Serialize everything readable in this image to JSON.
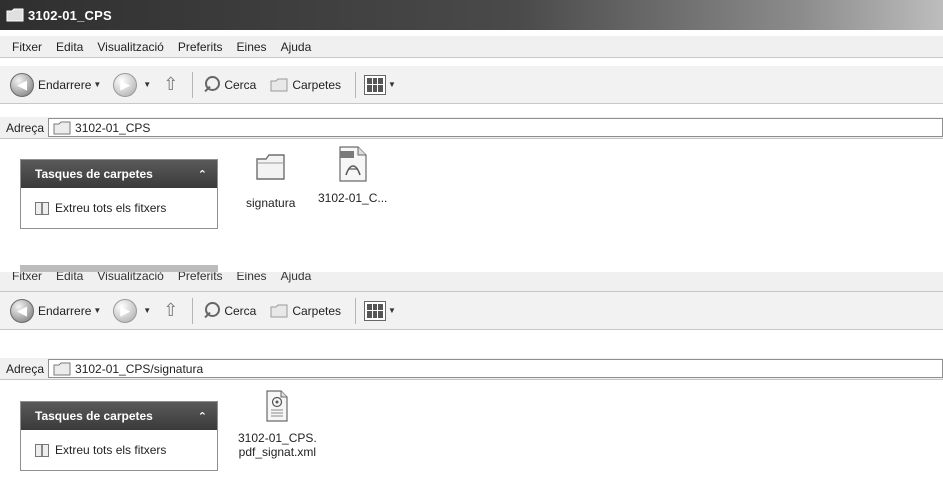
{
  "window": {
    "title": "3102-01_CPS"
  },
  "menu": {
    "items": [
      "Fitxer",
      "Edita",
      "Visualització",
      "Preferits",
      "Eines",
      "Ajuda"
    ]
  },
  "toolbar": {
    "back_label": "Endarrere",
    "search_label": "Cerca",
    "folders_label": "Carpetes"
  },
  "address": {
    "label": "Adreça",
    "top_value": "3102-01_CPS",
    "bottom_value": "3102-01_CPS/signatura"
  },
  "tasks": {
    "header": "Tasques de carpetes",
    "extract_label": "Extreu tots els fitxers"
  },
  "files_top": [
    {
      "name": "signatura",
      "type": "folder"
    },
    {
      "name": "3102-01_C...",
      "type": "pdf"
    }
  ],
  "files_bottom": [
    {
      "name_line1": "3102-01_CPS.",
      "name_line2": "pdf_signat.xml",
      "type": "xml"
    }
  ]
}
